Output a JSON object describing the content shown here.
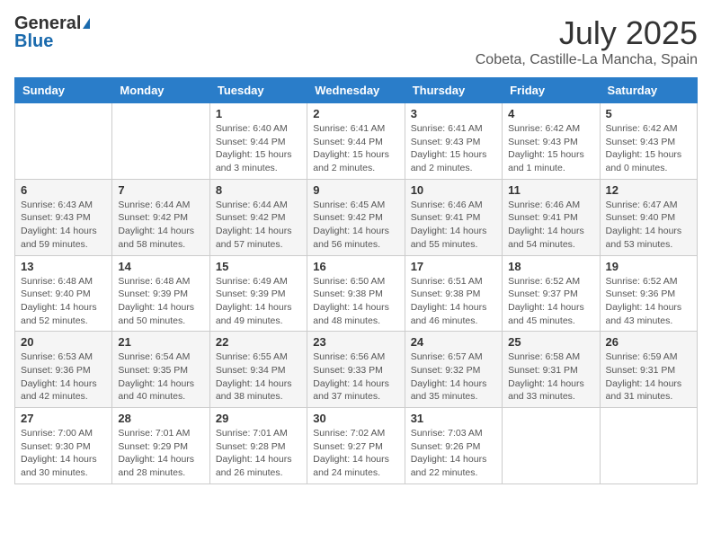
{
  "header": {
    "logo_general": "General",
    "logo_blue": "Blue",
    "title": "July 2025",
    "subtitle": "Cobeta, Castille-La Mancha, Spain"
  },
  "weekdays": [
    "Sunday",
    "Monday",
    "Tuesday",
    "Wednesday",
    "Thursday",
    "Friday",
    "Saturday"
  ],
  "weeks": [
    {
      "shade": false,
      "days": [
        {
          "num": "",
          "info": ""
        },
        {
          "num": "",
          "info": ""
        },
        {
          "num": "1",
          "info": "Sunrise: 6:40 AM\nSunset: 9:44 PM\nDaylight: 15 hours and 3 minutes."
        },
        {
          "num": "2",
          "info": "Sunrise: 6:41 AM\nSunset: 9:44 PM\nDaylight: 15 hours and 2 minutes."
        },
        {
          "num": "3",
          "info": "Sunrise: 6:41 AM\nSunset: 9:43 PM\nDaylight: 15 hours and 2 minutes."
        },
        {
          "num": "4",
          "info": "Sunrise: 6:42 AM\nSunset: 9:43 PM\nDaylight: 15 hours and 1 minute."
        },
        {
          "num": "5",
          "info": "Sunrise: 6:42 AM\nSunset: 9:43 PM\nDaylight: 15 hours and 0 minutes."
        }
      ]
    },
    {
      "shade": true,
      "days": [
        {
          "num": "6",
          "info": "Sunrise: 6:43 AM\nSunset: 9:43 PM\nDaylight: 14 hours and 59 minutes."
        },
        {
          "num": "7",
          "info": "Sunrise: 6:44 AM\nSunset: 9:42 PM\nDaylight: 14 hours and 58 minutes."
        },
        {
          "num": "8",
          "info": "Sunrise: 6:44 AM\nSunset: 9:42 PM\nDaylight: 14 hours and 57 minutes."
        },
        {
          "num": "9",
          "info": "Sunrise: 6:45 AM\nSunset: 9:42 PM\nDaylight: 14 hours and 56 minutes."
        },
        {
          "num": "10",
          "info": "Sunrise: 6:46 AM\nSunset: 9:41 PM\nDaylight: 14 hours and 55 minutes."
        },
        {
          "num": "11",
          "info": "Sunrise: 6:46 AM\nSunset: 9:41 PM\nDaylight: 14 hours and 54 minutes."
        },
        {
          "num": "12",
          "info": "Sunrise: 6:47 AM\nSunset: 9:40 PM\nDaylight: 14 hours and 53 minutes."
        }
      ]
    },
    {
      "shade": false,
      "days": [
        {
          "num": "13",
          "info": "Sunrise: 6:48 AM\nSunset: 9:40 PM\nDaylight: 14 hours and 52 minutes."
        },
        {
          "num": "14",
          "info": "Sunrise: 6:48 AM\nSunset: 9:39 PM\nDaylight: 14 hours and 50 minutes."
        },
        {
          "num": "15",
          "info": "Sunrise: 6:49 AM\nSunset: 9:39 PM\nDaylight: 14 hours and 49 minutes."
        },
        {
          "num": "16",
          "info": "Sunrise: 6:50 AM\nSunset: 9:38 PM\nDaylight: 14 hours and 48 minutes."
        },
        {
          "num": "17",
          "info": "Sunrise: 6:51 AM\nSunset: 9:38 PM\nDaylight: 14 hours and 46 minutes."
        },
        {
          "num": "18",
          "info": "Sunrise: 6:52 AM\nSunset: 9:37 PM\nDaylight: 14 hours and 45 minutes."
        },
        {
          "num": "19",
          "info": "Sunrise: 6:52 AM\nSunset: 9:36 PM\nDaylight: 14 hours and 43 minutes."
        }
      ]
    },
    {
      "shade": true,
      "days": [
        {
          "num": "20",
          "info": "Sunrise: 6:53 AM\nSunset: 9:36 PM\nDaylight: 14 hours and 42 minutes."
        },
        {
          "num": "21",
          "info": "Sunrise: 6:54 AM\nSunset: 9:35 PM\nDaylight: 14 hours and 40 minutes."
        },
        {
          "num": "22",
          "info": "Sunrise: 6:55 AM\nSunset: 9:34 PM\nDaylight: 14 hours and 38 minutes."
        },
        {
          "num": "23",
          "info": "Sunrise: 6:56 AM\nSunset: 9:33 PM\nDaylight: 14 hours and 37 minutes."
        },
        {
          "num": "24",
          "info": "Sunrise: 6:57 AM\nSunset: 9:32 PM\nDaylight: 14 hours and 35 minutes."
        },
        {
          "num": "25",
          "info": "Sunrise: 6:58 AM\nSunset: 9:31 PM\nDaylight: 14 hours and 33 minutes."
        },
        {
          "num": "26",
          "info": "Sunrise: 6:59 AM\nSunset: 9:31 PM\nDaylight: 14 hours and 31 minutes."
        }
      ]
    },
    {
      "shade": false,
      "days": [
        {
          "num": "27",
          "info": "Sunrise: 7:00 AM\nSunset: 9:30 PM\nDaylight: 14 hours and 30 minutes."
        },
        {
          "num": "28",
          "info": "Sunrise: 7:01 AM\nSunset: 9:29 PM\nDaylight: 14 hours and 28 minutes."
        },
        {
          "num": "29",
          "info": "Sunrise: 7:01 AM\nSunset: 9:28 PM\nDaylight: 14 hours and 26 minutes."
        },
        {
          "num": "30",
          "info": "Sunrise: 7:02 AM\nSunset: 9:27 PM\nDaylight: 14 hours and 24 minutes."
        },
        {
          "num": "31",
          "info": "Sunrise: 7:03 AM\nSunset: 9:26 PM\nDaylight: 14 hours and 22 minutes."
        },
        {
          "num": "",
          "info": ""
        },
        {
          "num": "",
          "info": ""
        }
      ]
    }
  ]
}
